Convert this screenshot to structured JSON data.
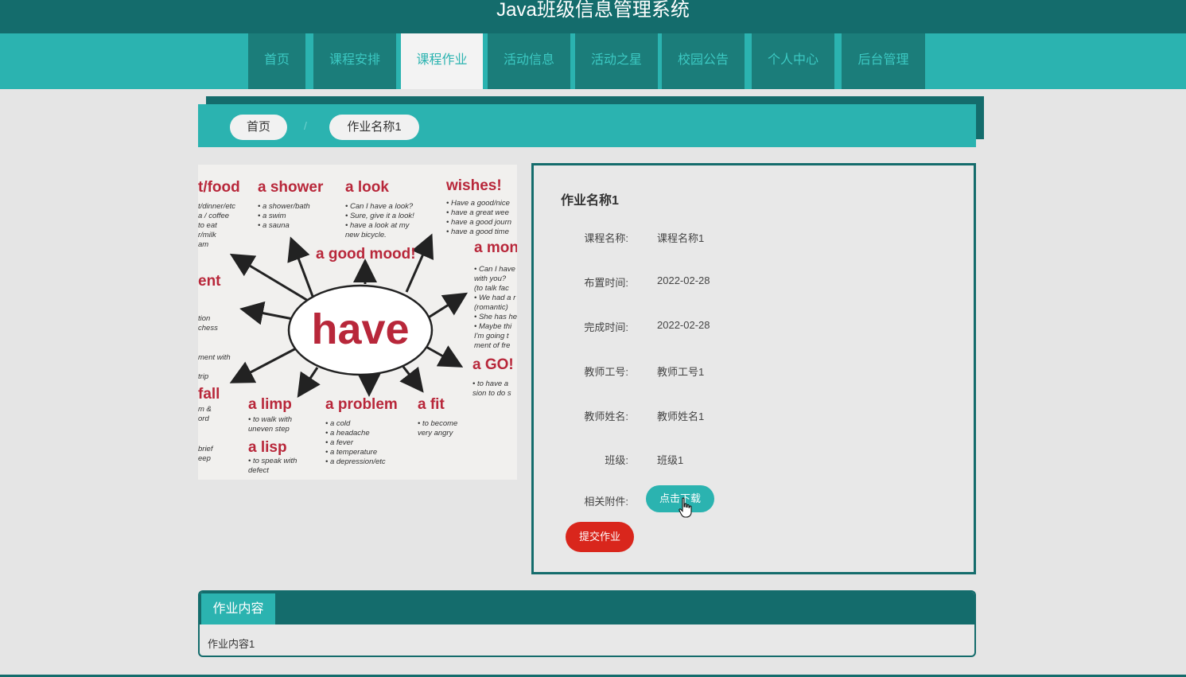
{
  "site": {
    "title": "Java班级信息管理系统"
  },
  "nav": [
    {
      "label": "首页",
      "active": false
    },
    {
      "label": "课程安排",
      "active": false
    },
    {
      "label": "课程作业",
      "active": true
    },
    {
      "label": "活动信息",
      "active": false
    },
    {
      "label": "活动之星",
      "active": false
    },
    {
      "label": "校园公告",
      "active": false
    },
    {
      "label": "个人中心",
      "active": false
    },
    {
      "label": "后台管理",
      "active": false
    }
  ],
  "breadcrumb": {
    "home": "首页",
    "separator": "/",
    "current": "作业名称1"
  },
  "image": {
    "center_word": "have",
    "phrases": [
      "t/food",
      "a shower",
      "a look",
      "wishes!",
      "a good mood!",
      "a mon",
      "ent",
      "a GO!",
      "fall",
      "a limp",
      "a problem",
      "a fit",
      "a lisp"
    ],
    "notes": {
      "food": [
        "t/dinner/etc",
        "a / coffee",
        "to eat",
        "r/milk",
        "am"
      ],
      "shower": [
        "• a shower/bath",
        "• a swim",
        "• a sauna"
      ],
      "look": [
        "• Can I have a look?",
        "• Sure, give it a look!",
        "• have a look at my",
        "new bicycle."
      ],
      "wishes": [
        "• Have a good/nice",
        "• have a great wee",
        "• have a good journ",
        "• have a good time"
      ],
      "mon": [
        "• Can I have",
        "with you?",
        "(to talk fac",
        "• We had a r",
        "(romantic)",
        "• She has he",
        "• Maybe thi",
        "I'm going t",
        "ment of fre"
      ],
      "ent": [
        "tion",
        "chess"
      ],
      "ment": [
        "ment with",
        "",
        "trip"
      ],
      "go": [
        "• to have a",
        "sion to do s"
      ],
      "fall": [
        "m &",
        "ord"
      ],
      "brief": [
        "brief",
        "eep"
      ],
      "limp": [
        "• to walk with",
        "uneven step"
      ],
      "problem": [
        "• a cold",
        "• a headache",
        "• a fever",
        "• a temperature",
        "• a depression/etc"
      ],
      "fit": [
        "• to become",
        "very angry"
      ],
      "lisp": [
        "• to speak with",
        "defect"
      ]
    }
  },
  "detail": {
    "title": "作业名称1",
    "fields": [
      {
        "label": "课程名称:",
        "value": "课程名称1"
      },
      {
        "label": "布置时间:",
        "value": "2022-02-28"
      },
      {
        "label": "完成时间:",
        "value": "2022-02-28"
      },
      {
        "label": "教师工号:",
        "value": "教师工号1"
      },
      {
        "label": "教师姓名:",
        "value": "教师姓名1"
      },
      {
        "label": "班级:",
        "value": "班级1"
      }
    ],
    "attachment_label": "相关附件:",
    "download_label": "点击下载",
    "submit_label": "提交作业"
  },
  "content": {
    "tab_label": "作业内容",
    "text": "作业内容1"
  },
  "colors": {
    "dark_teal": "#146c6c",
    "teal": "#2bb3b0",
    "red": "#d9261c"
  }
}
